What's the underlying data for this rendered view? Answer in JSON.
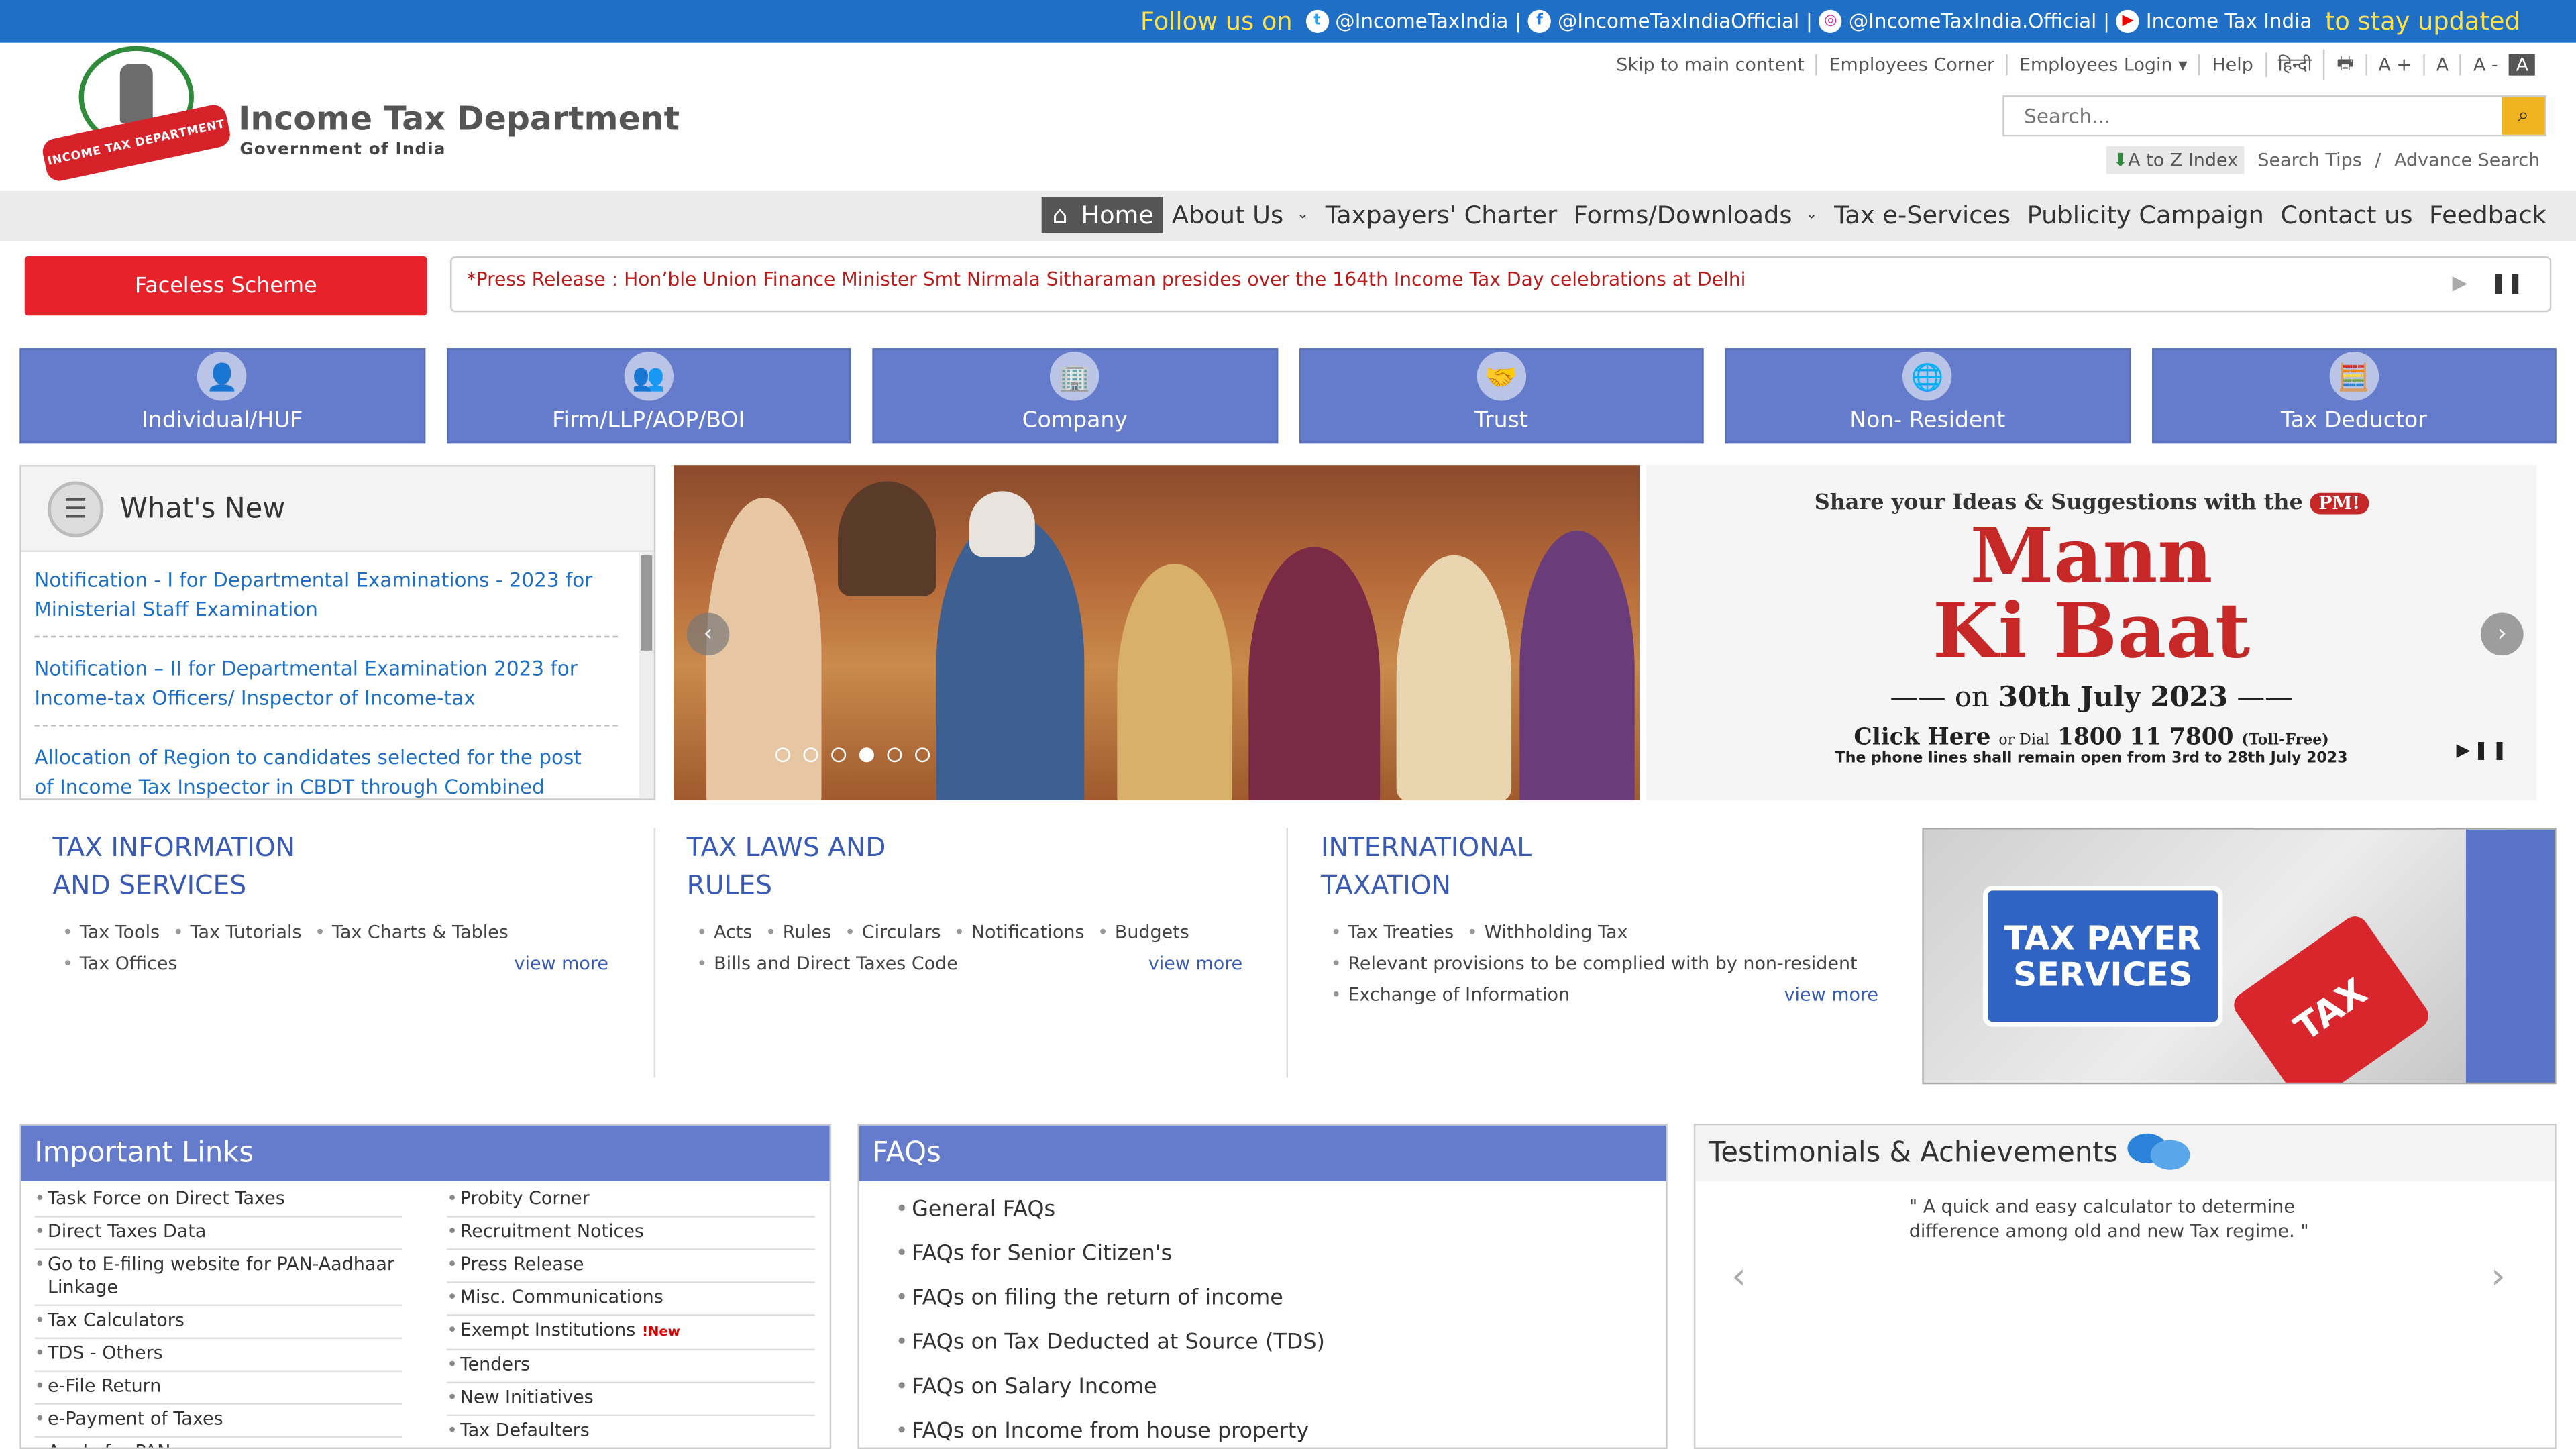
{
  "topbar": {
    "follow": "Follow us on",
    "twitter": "@IncomeTaxIndia",
    "facebook": "@IncomeTaxIndiaOfficial",
    "instagram": "@IncomeTaxIndia.Official",
    "youtube": "Income Tax India",
    "stay": "to stay updated"
  },
  "header": {
    "ribbon": "INCOME TAX DEPARTMENT",
    "title": "Income Tax Department",
    "subtitle": "Government of India"
  },
  "utility": {
    "skip": "Skip to main content",
    "employees_corner": "Employees Corner",
    "employees_login": "Employees Login ▾",
    "help": "Help",
    "hindi": "हिन्दी",
    "font_plus": "A +",
    "font_normal": "A",
    "font_minus": "A -",
    "font_contrast": "A"
  },
  "search": {
    "placeholder": "Search...",
    "atoz": "A to Z Index",
    "tips": "Search Tips",
    "advance": "Advance Search"
  },
  "nav": {
    "home": "Home",
    "about": "About Us",
    "charter": "Taxpayers' Charter",
    "forms": "Forms/Downloads",
    "eservices": "Tax e-Services",
    "publicity": "Publicity Campaign",
    "contact": "Contact us",
    "feedback": "Feedback"
  },
  "faceless": "Faceless Scheme",
  "ticker": "*Press Release : Hon’ble Union Finance Minister Smt Nirmala Sitharaman presides over the 164th Income Tax Day celebrations at Delhi",
  "tiles": [
    "Individual/HUF",
    "Firm/LLP/AOP/BOI",
    "Company",
    "Trust",
    "Non- Resident",
    "Tax Deductor"
  ],
  "whats_new": {
    "title": "What's New",
    "items": [
      "Notification - I for Departmental Examinations - 2023 for Ministerial Staff Examination",
      "Notification – II for Departmental Examination 2023 for Income-tax Officers/ Inspector of Income-tax",
      "Allocation of Region to candidates selected for the post of Income Tax Inspector in CBDT through Combined Graduate"
    ]
  },
  "banner": {
    "share": "Share your Ideas & Suggestions with the",
    "pm": "PM!",
    "line1": "Mann",
    "line2": "Ki Baat",
    "date_on": "on",
    "date": "30th July 2023",
    "click": "Click Here",
    "or_dial": "or Dial",
    "phone": "1800 11 7800",
    "tollfree": "(Toll-Free)",
    "note": "The phone lines shall remain open from 3rd to 28th July 2023"
  },
  "info": {
    "col1": {
      "title1": "TAX INFORMATION",
      "title2": "AND SERVICES",
      "items": [
        "Tax Tools",
        "Tax Tutorials",
        "Tax Charts & Tables",
        "Tax Offices"
      ],
      "more": "view more"
    },
    "col2": {
      "title1": "TAX LAWS AND",
      "title2": "RULES",
      "items": [
        "Acts",
        "Rules",
        "Circulars",
        "Notifications",
        "Budgets",
        "Bills and Direct Taxes Code"
      ],
      "more": "view more"
    },
    "col3": {
      "title1": "INTERNATIONAL",
      "title2": "TAXATION",
      "items": [
        "Tax Treaties",
        "Withholding Tax",
        "Relevant provisions to be complied with by non-resident",
        "Exchange of Information"
      ],
      "more": "view more"
    }
  },
  "tps": {
    "line1": "TAX PAYER",
    "line2": "SERVICES",
    "key": "TAX"
  },
  "important_links": {
    "title": "Important Links",
    "left": [
      "Task Force on Direct Taxes",
      "Direct Taxes Data",
      "Go to E-filing website for PAN-Aadhaar Linkage",
      "Tax Calculators",
      "TDS - Others",
      "e-File Return",
      "e-Payment of Taxes",
      "Apply for PAN"
    ],
    "right": [
      "Probity Corner",
      "Recruitment Notices",
      "Press Release",
      "Misc. Communications",
      "Exempt Institutions",
      "Tenders",
      "New Initiatives",
      "Tax Defaulters"
    ],
    "new_tag": "!New"
  },
  "faqs": {
    "title": "FAQs",
    "items": [
      "General FAQs",
      "FAQs for Senior Citizen's",
      "FAQs on filing the return of income",
      "FAQs on Tax Deducted at Source (TDS)",
      "FAQs on Salary Income",
      "FAQs on Income from house property"
    ]
  },
  "testimonials": {
    "title": "Testimonials & Achievements",
    "quote": "\" A quick and easy calculator to determine difference among old and new Tax regime. \""
  }
}
